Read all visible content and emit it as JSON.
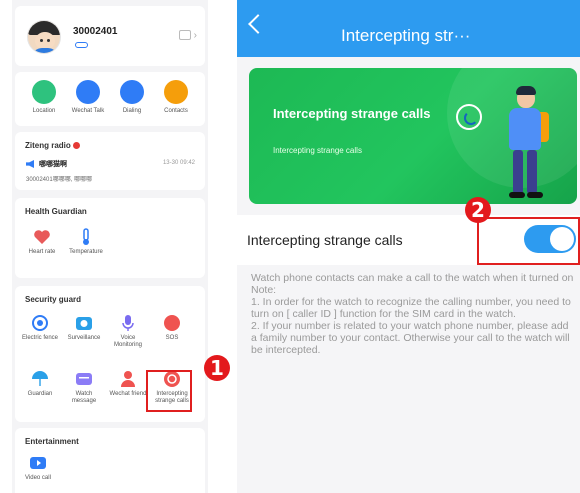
{
  "left": {
    "profile": {
      "device_id": "30002401"
    },
    "actions": [
      {
        "label": "Location",
        "icon": "location-icon",
        "color": "#2ec27e"
      },
      {
        "label": "Wechat Talk",
        "icon": "chat-icon",
        "color": "#2f7cf6"
      },
      {
        "label": "Dialing",
        "icon": "dial-icon",
        "color": "#2f7cf6"
      },
      {
        "label": "Contacts",
        "icon": "contacts-icon",
        "color": "#f59e0b"
      }
    ],
    "radio": {
      "title": "Ziteng radio",
      "sender": "哪哪猫啊",
      "time": "13-30 09:42",
      "body": "30002401哪哪哪, 哪哪哪"
    },
    "health": {
      "title": "Health Guardian",
      "items": [
        {
          "label": "Heart rate",
          "icon": "heart-icon"
        },
        {
          "label": "Temperature",
          "icon": "thermometer-icon"
        }
      ]
    },
    "security": {
      "title": "Security guard",
      "row1": [
        {
          "label": "Electric fence",
          "icon": "fence-icon"
        },
        {
          "label": "Surveillance",
          "icon": "camera-icon"
        },
        {
          "label": "Voice Monitoring",
          "icon": "microphone-icon"
        },
        {
          "label": "SOS",
          "icon": "sos-icon"
        }
      ],
      "row2": [
        {
          "label": "Guardian",
          "icon": "umbrella-icon"
        },
        {
          "label": "Watch message",
          "icon": "message-icon"
        },
        {
          "label": "Wechat friend",
          "icon": "friend-icon"
        },
        {
          "label": "Intercepting strange calls",
          "icon": "intercept-calls-icon"
        }
      ]
    },
    "entertainment": {
      "title": "Entertainment",
      "items": [
        {
          "label": "Video call",
          "icon": "video-call-icon"
        }
      ]
    }
  },
  "badges": {
    "one": "1",
    "two": "2"
  },
  "right": {
    "nav_title": "Intercepting str···",
    "banner": {
      "title": "Intercepting strange calls",
      "subtitle": "Intercepting strange calls"
    },
    "setting": {
      "label": "Intercepting strange calls",
      "enabled": true
    },
    "description": [
      "Watch phone contacts can make a call to the watch when it turned on",
      "Note:",
      "1. In order for the watch to recognize the calling number, you need to turn on [ caller ID ] function for the SIM card in the watch.",
      "2. If your number is related to your watch phone number, please add a family number to your contact. Otherwise your call to the watch will be intercepted."
    ]
  },
  "colors": {
    "accent": "#2d9bf0",
    "highlight": "#e01f1f",
    "banner_green": "#1db954"
  }
}
